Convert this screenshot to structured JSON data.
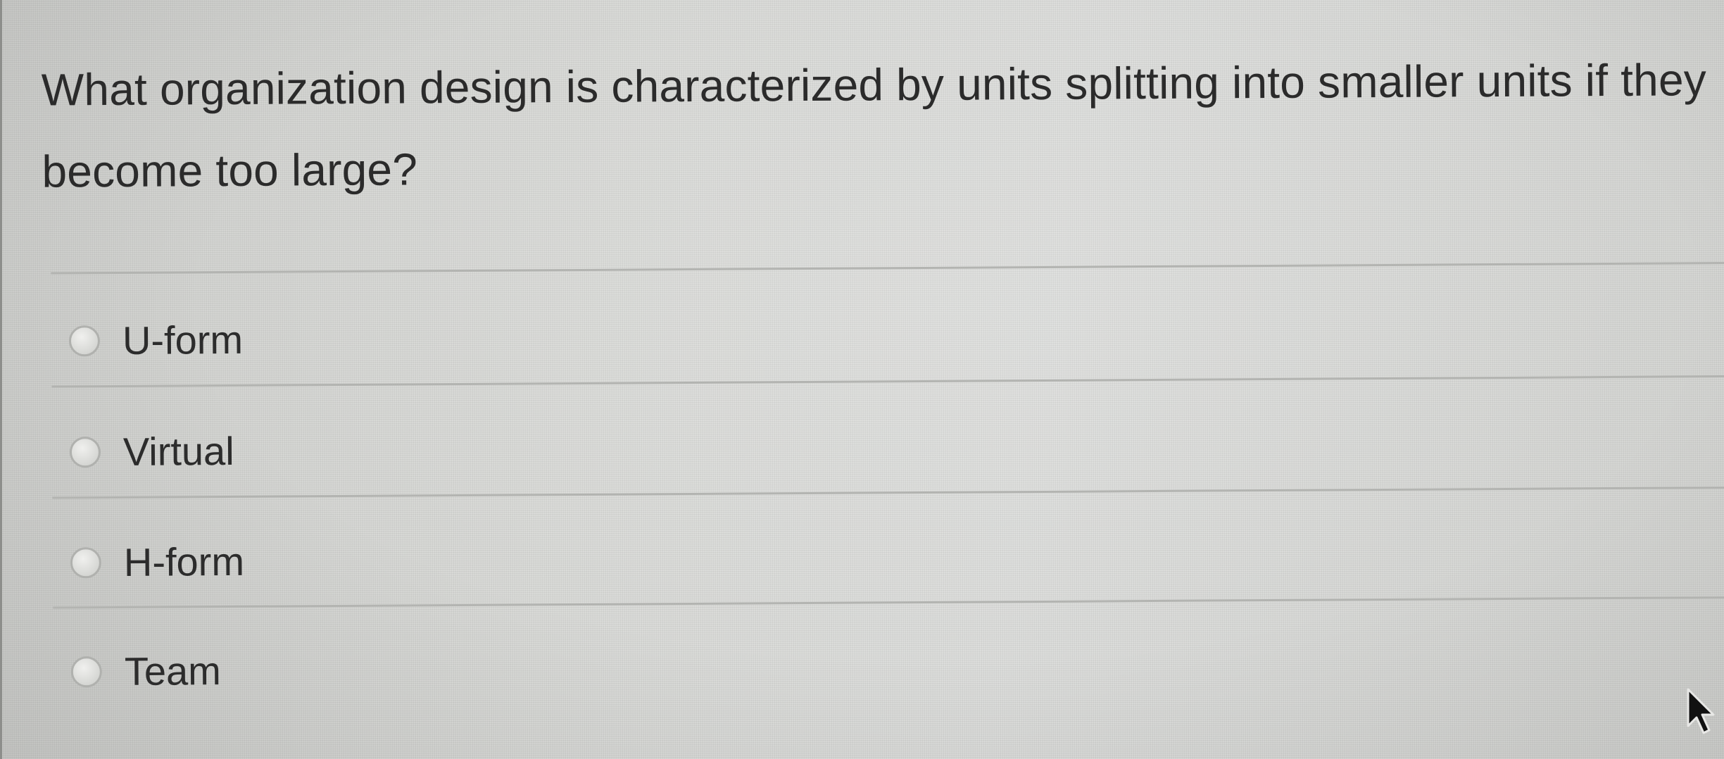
{
  "question": {
    "text": "What organization design is characterized by units splitting into smaller units if they become too large?"
  },
  "answers": [
    {
      "label": "U-form",
      "selected": false
    },
    {
      "label": "Virtual",
      "selected": false
    },
    {
      "label": "H-form",
      "selected": false
    },
    {
      "label": "Team",
      "selected": false
    }
  ],
  "icons": {
    "radio": "radio-button-unselected-icon",
    "cursor": "mouse-pointer-arrow-icon"
  },
  "colors": {
    "background": "#d8d9d6",
    "text": "#2b2b2b",
    "divider": "#b3b4b1"
  }
}
